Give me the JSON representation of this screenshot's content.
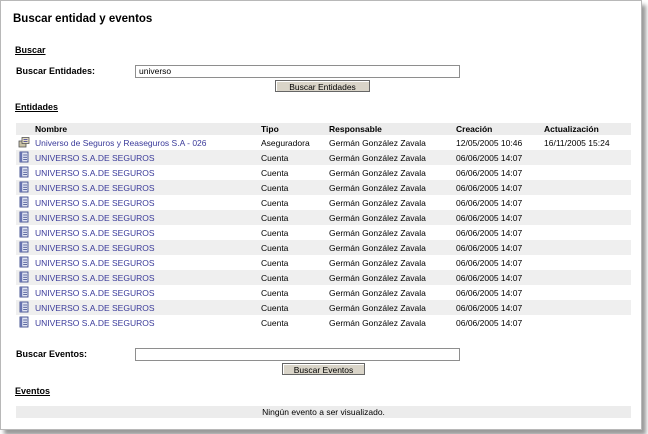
{
  "page": {
    "title": "Buscar entidad y eventos"
  },
  "search": {
    "section_title": "Buscar",
    "entities_label": "Buscar Entidades:",
    "entities_value": "universo",
    "entities_button": "Buscar Entidades",
    "events_label": "Buscar Eventos:",
    "events_value": "",
    "events_button": "Buscar Eventos"
  },
  "entities": {
    "section_title": "Entidades",
    "columns": [
      "Nombre",
      "Tipo",
      "Responsable",
      "Creación",
      "Actualización"
    ],
    "rows": [
      {
        "icon": "company-icon",
        "nombre": "Universo de Seguros y Reaseguros S.A - 026",
        "tipo": "Aseguradora",
        "responsable": "Germán González Zavala",
        "creacion": "12/05/2005 10:46",
        "actualizacion": "16/11/2005 15:24"
      },
      {
        "icon": "account-book-icon",
        "nombre": "UNIVERSO S.A.DE SEGUROS",
        "tipo": "Cuenta",
        "responsable": "Germán González Zavala",
        "creacion": "06/06/2005 14:07",
        "actualizacion": ""
      },
      {
        "icon": "account-book-icon",
        "nombre": "UNIVERSO S.A.DE SEGUROS",
        "tipo": "Cuenta",
        "responsable": "Germán González Zavala",
        "creacion": "06/06/2005 14:07",
        "actualizacion": ""
      },
      {
        "icon": "account-book-icon",
        "nombre": "UNIVERSO S.A.DE SEGUROS",
        "tipo": "Cuenta",
        "responsable": "Germán González Zavala",
        "creacion": "06/06/2005 14:07",
        "actualizacion": ""
      },
      {
        "icon": "account-book-icon",
        "nombre": "UNIVERSO S.A.DE SEGUROS",
        "tipo": "Cuenta",
        "responsable": "Germán González Zavala",
        "creacion": "06/06/2005 14:07",
        "actualizacion": ""
      },
      {
        "icon": "account-book-icon",
        "nombre": "UNIVERSO S.A.DE SEGUROS",
        "tipo": "Cuenta",
        "responsable": "Germán González Zavala",
        "creacion": "06/06/2005 14:07",
        "actualizacion": ""
      },
      {
        "icon": "account-book-icon",
        "nombre": "UNIVERSO S.A.DE SEGUROS",
        "tipo": "Cuenta",
        "responsable": "Germán González Zavala",
        "creacion": "06/06/2005 14:07",
        "actualizacion": ""
      },
      {
        "icon": "account-book-icon",
        "nombre": "UNIVERSO S.A.DE SEGUROS",
        "tipo": "Cuenta",
        "responsable": "Germán González Zavala",
        "creacion": "06/06/2005 14:07",
        "actualizacion": ""
      },
      {
        "icon": "account-book-icon",
        "nombre": "UNIVERSO S.A.DE SEGUROS",
        "tipo": "Cuenta",
        "responsable": "Germán González Zavala",
        "creacion": "06/06/2005 14:07",
        "actualizacion": ""
      },
      {
        "icon": "account-book-icon",
        "nombre": "UNIVERSO S.A.DE SEGUROS",
        "tipo": "Cuenta",
        "responsable": "Germán González Zavala",
        "creacion": "06/06/2005 14:07",
        "actualizacion": ""
      },
      {
        "icon": "account-book-icon",
        "nombre": "UNIVERSO S.A.DE SEGUROS",
        "tipo": "Cuenta",
        "responsable": "Germán González Zavala",
        "creacion": "06/06/2005 14:07",
        "actualizacion": ""
      },
      {
        "icon": "account-book-icon",
        "nombre": "UNIVERSO S.A.DE SEGUROS",
        "tipo": "Cuenta",
        "responsable": "Germán González Zavala",
        "creacion": "06/06/2005 14:07",
        "actualizacion": ""
      },
      {
        "icon": "account-book-icon",
        "nombre": "UNIVERSO S.A.DE SEGUROS",
        "tipo": "Cuenta",
        "responsable": "Germán González Zavala",
        "creacion": "06/06/2005 14:07",
        "actualizacion": ""
      }
    ]
  },
  "events": {
    "section_title": "Eventos",
    "empty_message": "Ningún evento a ser visualizado."
  },
  "colors": {
    "link": "#3a3a9a",
    "header_bg": "#ececec",
    "row_alt_bg": "#efefef",
    "button_bg": "#d9d4c8"
  }
}
